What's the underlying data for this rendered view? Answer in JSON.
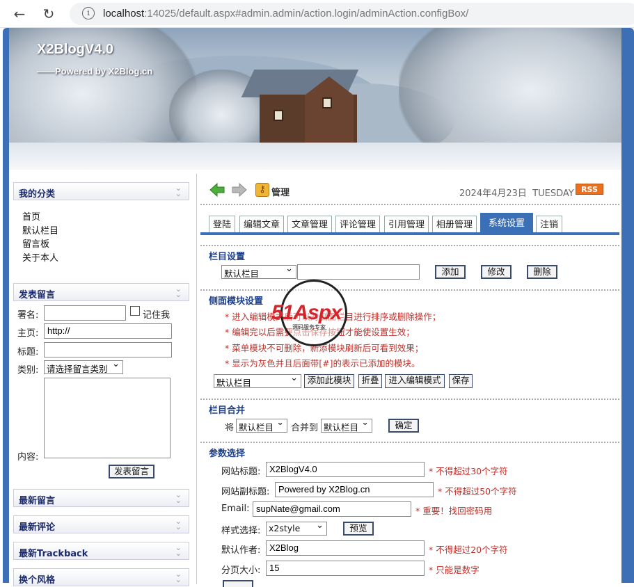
{
  "browser": {
    "url_host": "localhost",
    "url_rest": ":14025/default.aspx#admin.admin/action.login/adminAction.configBox/"
  },
  "header": {
    "title": "X2BlogV4.0",
    "subtitle": "——Powered by X2Blog.cn"
  },
  "sidebar": {
    "categories_title": "我的分类",
    "categories": [
      "首页",
      "默认栏目",
      "留言板",
      "关于本人"
    ],
    "guestbook_title": "发表留言",
    "signature_label": "署名:",
    "remember_label": "记住我",
    "homepage_label": "主页:",
    "homepage_value": "http://",
    "subject_label": "标题:",
    "type_label": "类别:",
    "type_value": "请选择留言类别",
    "content_label": "内容:",
    "submit_label": "发表留言",
    "recent_comments_title": "最新留言",
    "recent_reviews_title": "最新评论",
    "trackback_title": "最新Trackback",
    "style_title": "换个风格"
  },
  "toolbar": {
    "manage_label": "管理",
    "date": "2024年4月23日",
    "weekday": "TUESDAY",
    "rss": "RSS"
  },
  "tabs": [
    "登陆",
    "编辑文章",
    "文章管理",
    "评论管理",
    "引用管理",
    "相册管理",
    "系统设置",
    "注销"
  ],
  "column_settings": {
    "title": "栏目设置",
    "select_value": "默认栏目",
    "add": "添加",
    "edit": "修改",
    "delete": "删除"
  },
  "side_module": {
    "title": "侧面模块设置",
    "notes": [
      "* 进入编辑模式后可以对侧面栏目进行排序或删除操作；",
      "* 编辑完以后需要点击保存按钮才能使设置生效；",
      "* 菜单模块不可删除，新添模块刷新后可看到效果；",
      "* 显示为灰色并且后面带[#]的表示已添加的模块。"
    ],
    "select_value": "默认栏目",
    "add_module": "添加此模块",
    "collapse": "折叠",
    "edit_mode": "进入编辑模式",
    "save": "保存"
  },
  "merge": {
    "title": "栏目合并",
    "prefix": "将",
    "from_value": "默认栏目",
    "middle": "合并到",
    "to_value": "默认栏目",
    "confirm": "确定"
  },
  "params": {
    "title": "参数选择",
    "site_title_label": "网站标题:",
    "site_title_value": "X2BlogV4.0",
    "site_title_note": "* 不得超过30个字符",
    "site_subtitle_label": "网站副标题:",
    "site_subtitle_value": "Powered by X2Blog.cn",
    "site_subtitle_note": "* 不得超过50个字符",
    "email_label": "Email:",
    "email_value": "supNate@gmail.com",
    "email_note": "* 重要！找回密码用",
    "style_label": "样式选择:",
    "style_value": "x2style",
    "preview": "预览",
    "author_label": "默认作者:",
    "author_value": "X2Blog",
    "author_note": "* 不得超过20个字符",
    "page_size_label": "分页大小:",
    "page_size_value": "15",
    "page_size_note": "* 只能是数字"
  },
  "watermark": {
    "brand": "51Aspx",
    "tagline": "源码服务专家"
  }
}
